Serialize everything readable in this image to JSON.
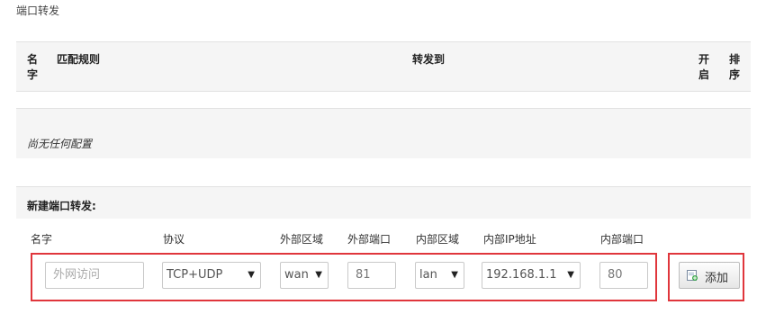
{
  "page": {
    "title": "端口转发"
  },
  "table": {
    "headers": {
      "name": "名字",
      "match_rule": "匹配规则",
      "forward_to": "转发到",
      "enable": "开启",
      "sort": "排序"
    },
    "empty_text": "尚无任何配置"
  },
  "new_section": {
    "title": "新建端口转发:",
    "labels": {
      "name": "名字",
      "protocol": "协议",
      "external_zone": "外部区域",
      "external_port": "外部端口",
      "internal_zone": "内部区域",
      "internal_ip": "内部IP地址",
      "internal_port": "内部端口"
    },
    "fields": {
      "name_placeholder": "外网访问",
      "protocol": "TCP+UDP",
      "external_zone": "wan",
      "external_port": "81",
      "internal_zone": "lan",
      "internal_ip": "192.168.1.1",
      "internal_port": "80"
    },
    "add_label": "添加"
  },
  "colors": {
    "highlight": "#e0363c",
    "panel": "#f5f5f5"
  },
  "icons": {
    "select_arrow": "▼",
    "add_icon": "document-add-icon"
  }
}
